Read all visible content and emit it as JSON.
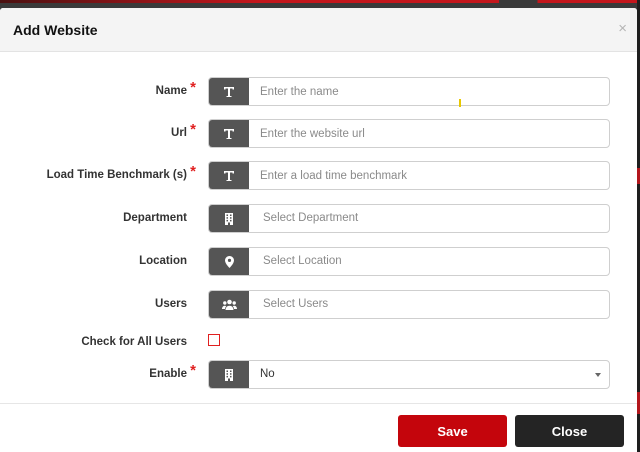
{
  "modal": {
    "title": "Add Website",
    "close_symbol": "×"
  },
  "form": {
    "required_mark": "*",
    "name": {
      "label": "Name",
      "placeholder": "Enter the name",
      "icon": "text-icon",
      "required": true
    },
    "url": {
      "label": "Url",
      "placeholder": "Enter the website url",
      "icon": "text-icon",
      "required": true
    },
    "benchmark": {
      "label": "Load Time Benchmark (s)",
      "placeholder": "Enter a load time benchmark",
      "icon": "text-icon",
      "required": true
    },
    "department": {
      "label": "Department",
      "placeholder": "Select Department",
      "icon": "building-icon"
    },
    "location": {
      "label": "Location",
      "placeholder": "Select Location",
      "icon": "map-pin-icon"
    },
    "users": {
      "label": "Users",
      "placeholder": "Select Users",
      "icon": "users-icon"
    },
    "check_all_users": {
      "label": "Check for All Users",
      "checked": false
    },
    "enable": {
      "label": "Enable",
      "value": "No",
      "icon": "building-icon",
      "required": true
    }
  },
  "footer": {
    "save_label": "Save",
    "close_label": "Close"
  },
  "colors": {
    "addon_bg": "#555555",
    "save_bg": "#c4050c",
    "close_bg": "#242424",
    "required": "#e02020"
  }
}
